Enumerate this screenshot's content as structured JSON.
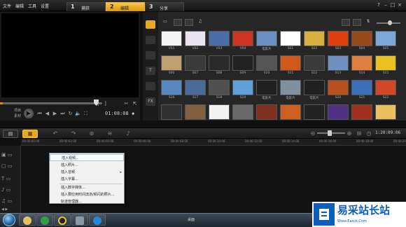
{
  "menubar": {
    "menus": [
      "文件",
      "编辑",
      "工具",
      "设置"
    ],
    "steps": [
      {
        "num": "1",
        "label": "捕获"
      },
      {
        "num": "2",
        "label": "编辑"
      },
      {
        "num": "3",
        "label": "分享"
      }
    ],
    "window_controls": [
      "?",
      "–",
      "□",
      "×"
    ]
  },
  "player": {
    "mode_project": "项目",
    "mode_clip": "素材",
    "timecode": "01:08:08",
    "timecode_suffix": "◆"
  },
  "library": {
    "sidebar": [
      "媒体",
      "即时",
      "转场",
      "标题",
      "图形",
      "滤镜"
    ],
    "thumbs": [
      [
        "V01",
        "V02",
        "V03",
        "V04",
        "电影片",
        "S01",
        "S02",
        "S03",
        "S04",
        "S05"
      ],
      [
        "S06",
        "S07",
        "S08",
        "S09",
        "S10",
        "S11",
        "S12",
        "S13",
        "S14",
        "S15"
      ],
      [
        "S16",
        "S17",
        "S18",
        "S19",
        "电影片",
        "电影片",
        "电影片",
        "S20",
        "S21",
        "S22"
      ],
      [
        "",
        "",
        "",
        "",
        "",
        "",
        "",
        "",
        "",
        ""
      ]
    ],
    "colors": {
      "accent": "#e8a820"
    }
  },
  "timeline": {
    "time": "1:20:09:06",
    "ruler": [
      "00:00:00:00",
      "00:00:02:00",
      "00:00:04:00",
      "00:00:06:00",
      "00:00:08:00",
      "00:00:10:00",
      "00:00:12:00",
      "00:00:14:00",
      "00:00:16:00",
      "00:00:18:00",
      "00:00:20:00"
    ]
  },
  "context_menu": {
    "items": [
      {
        "label": "插入视频...",
        "highlighted": true
      },
      {
        "label": "插入照片...",
        "highlighted": false
      },
      {
        "label": "插入音频",
        "highlighted": false,
        "submenu": true
      },
      {
        "label": "插入字幕...",
        "highlighted": false
      },
      {
        "label": "插入数字媒体...",
        "highlighted": false
      },
      {
        "label": "插入要应用时间流逝/频闪的照片...",
        "highlighted": false
      },
      {
        "label": "轨道管理器...",
        "highlighted": false
      }
    ]
  },
  "taskbar": {
    "tray_text": "桌面"
  },
  "watermark": {
    "title": "易采站长站",
    "url": "Www.Easck.Com"
  }
}
